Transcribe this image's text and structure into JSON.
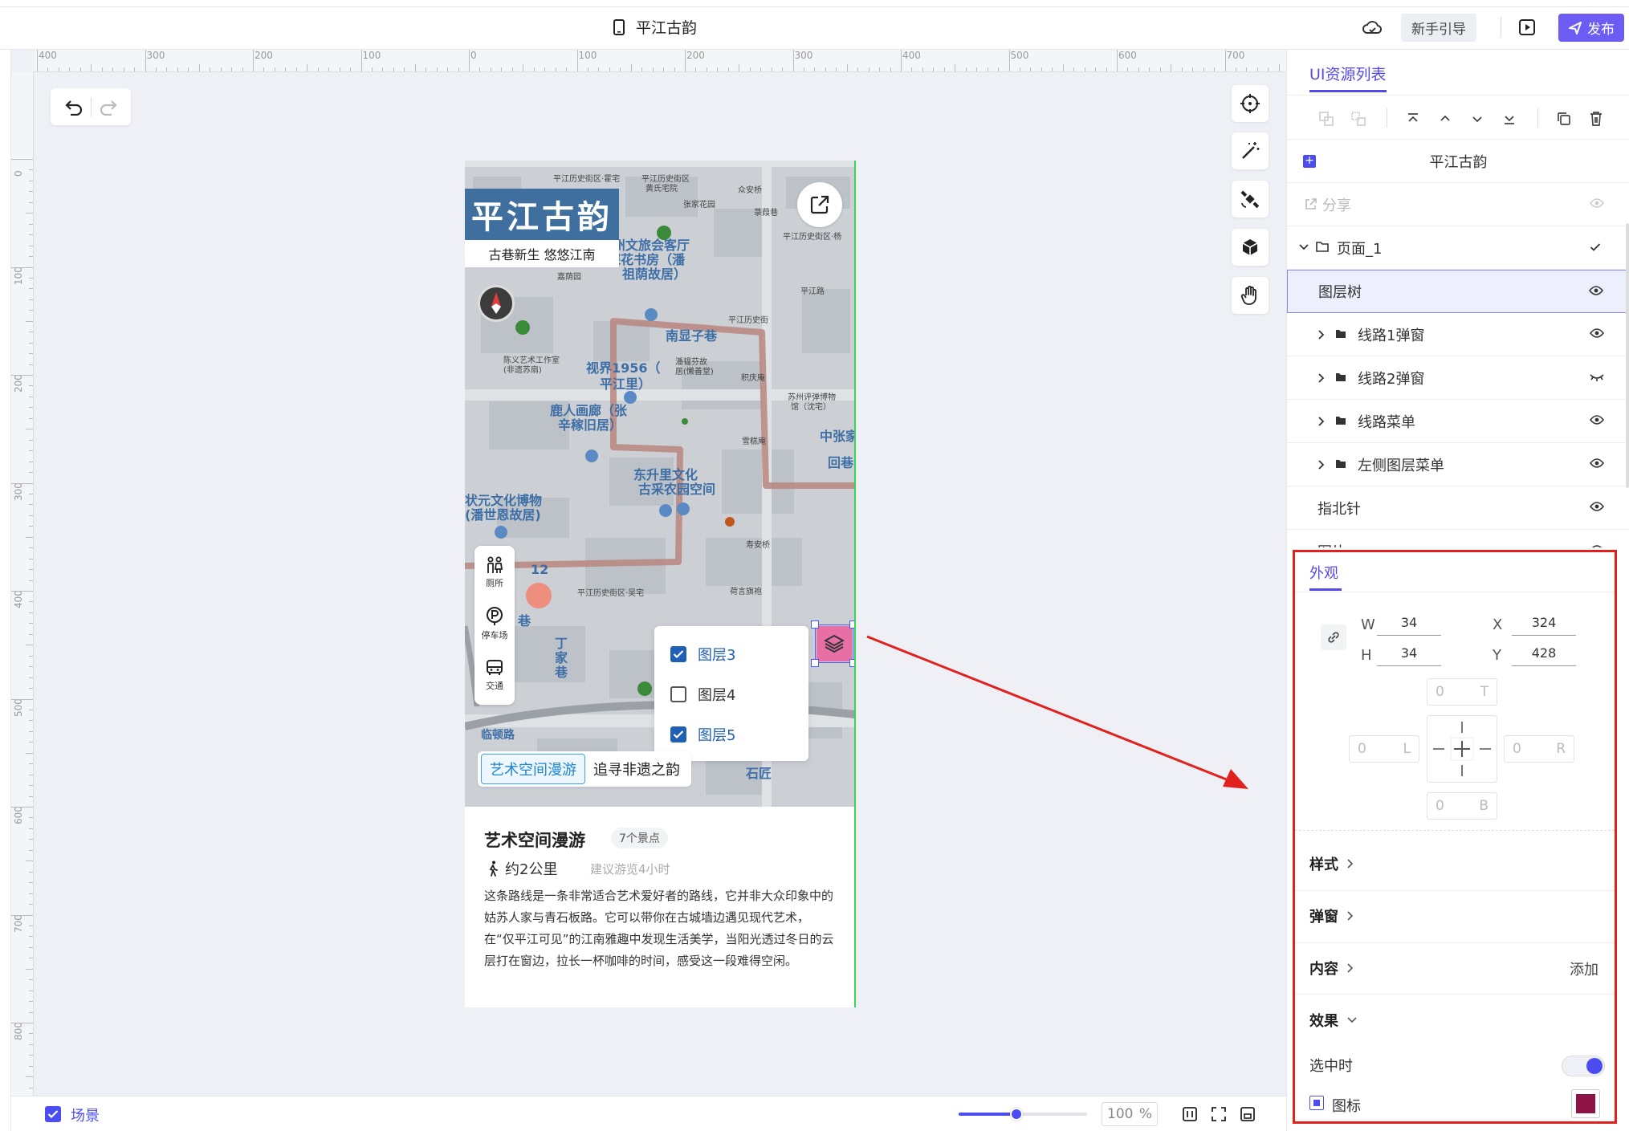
{
  "header": {
    "title": "平江古韵",
    "guide_label": "新手引导",
    "publish_label": "发布"
  },
  "ruler": {
    "top_labels": [
      "400",
      "300",
      "200",
      "100",
      "0",
      "100",
      "200",
      "300",
      "400",
      "500",
      "600",
      "700"
    ],
    "left_labels": [
      "0",
      "100",
      "200",
      "300",
      "400",
      "500",
      "600",
      "700",
      "800"
    ]
  },
  "canvas": {
    "brand_title": "平江古韵",
    "brand_subtitle": "古巷新生  悠悠江南",
    "map_labels": [
      "平江历史街区·霍宅",
      "平江历史街区",
      "黄氏宅院",
      "众安桥",
      "张家花园",
      "菉葭巷",
      "平江历史街区·杨",
      "苏州文旅会客厅",
      "·探花书房（潘",
      "祖荫故居）",
      "嘉荫园",
      "平江路",
      "平江历史街",
      "南显子巷",
      "陈义艺术工作室",
      "(非遗苏扇)",
      "视界1956（",
      "潘韫芬故",
      "居(懒善堂)",
      "平江里）",
      "积庆庵",
      "苏州评弹博物",
      "馆（沈宅）",
      "鹿人画廊（张",
      "辛稼旧居）",
      "中张家",
      "雪糕庵",
      "回巷",
      "东升里文化",
      "古采农园空间",
      "状元文化博物",
      "(潘世恩故居)",
      "寿安桥",
      "平江历史街区·吴宅",
      "荷言旗袍",
      "12",
      "巷",
      "丁",
      "家",
      "巷",
      "临顿路",
      "石匠"
    ],
    "left_menu": [
      {
        "label": "厕所"
      },
      {
        "label": "停车场"
      },
      {
        "label": "交通"
      }
    ],
    "layers": [
      {
        "label": "图层3",
        "checked": true
      },
      {
        "label": "图层4",
        "checked": false
      },
      {
        "label": "图层5",
        "checked": true
      }
    ],
    "route_tabs": [
      {
        "label": "艺术空间漫游",
        "active": true
      },
      {
        "label": "追寻非遗之韵",
        "active": false
      }
    ],
    "card": {
      "title": "艺术空间漫游",
      "badge": "7个景点",
      "distance": "约2公里",
      "hint": "建议游览4小时",
      "description": "这条路线是一条非常适合艺术爱好者的路线，它并非大众印象中的姑苏人家与青石板路。它可以带你在古城墙边遇见现代艺术，在“仅平江可见”的江南雅趣中发现生活美学，当阳光透过冬日的云层打在窗边，拉长一杯咖啡的时间，感受这一段难得空闲。"
    }
  },
  "bottom": {
    "scene_label": "场景",
    "zoom_value": "100",
    "zoom_unit": "%",
    "zoom_fraction": 0.45
  },
  "right_panel": {
    "tab_label": "UI资源列表",
    "root_label": "平江古韵",
    "share_label": "分享",
    "page_label": "页面_1",
    "tree": [
      {
        "label": "图层树",
        "selected": true,
        "folder": false,
        "visible": true
      },
      {
        "label": "线路1弹窗",
        "selected": false,
        "folder": true,
        "visible": true
      },
      {
        "label": "线路2弹窗",
        "selected": false,
        "folder": true,
        "visible": false
      },
      {
        "label": "线路菜单",
        "selected": false,
        "folder": true,
        "visible": true
      },
      {
        "label": "左侧图层菜单",
        "selected": false,
        "folder": true,
        "visible": true
      },
      {
        "label": "指北针",
        "selected": false,
        "folder": false,
        "visible": true
      },
      {
        "label": "图片",
        "selected": false,
        "folder": false,
        "visible": true
      }
    ]
  },
  "appearance": {
    "tab_label": "外观",
    "w_label": "W",
    "w_value": "34",
    "h_label": "H",
    "h_value": "34",
    "x_label": "X",
    "x_value": "324",
    "y_label": "Y",
    "y_value": "428",
    "pad_top": "0",
    "pad_top_label": "T",
    "pad_left": "0",
    "pad_left_label": "L",
    "pad_right": "0",
    "pad_right_label": "R",
    "pad_bottom": "0",
    "pad_bottom_label": "B",
    "sections": {
      "style": "样式",
      "popup": "弹窗",
      "content": "内容",
      "content_add": "添加",
      "effect": "效果"
    },
    "selected_label": "选中时",
    "selected_on": true,
    "icon_label": "图标",
    "icon_color": "#8e1446"
  },
  "colors": {
    "accent": "#6d5cf3",
    "highlight": "#e0211e",
    "route": "#b8867f"
  }
}
